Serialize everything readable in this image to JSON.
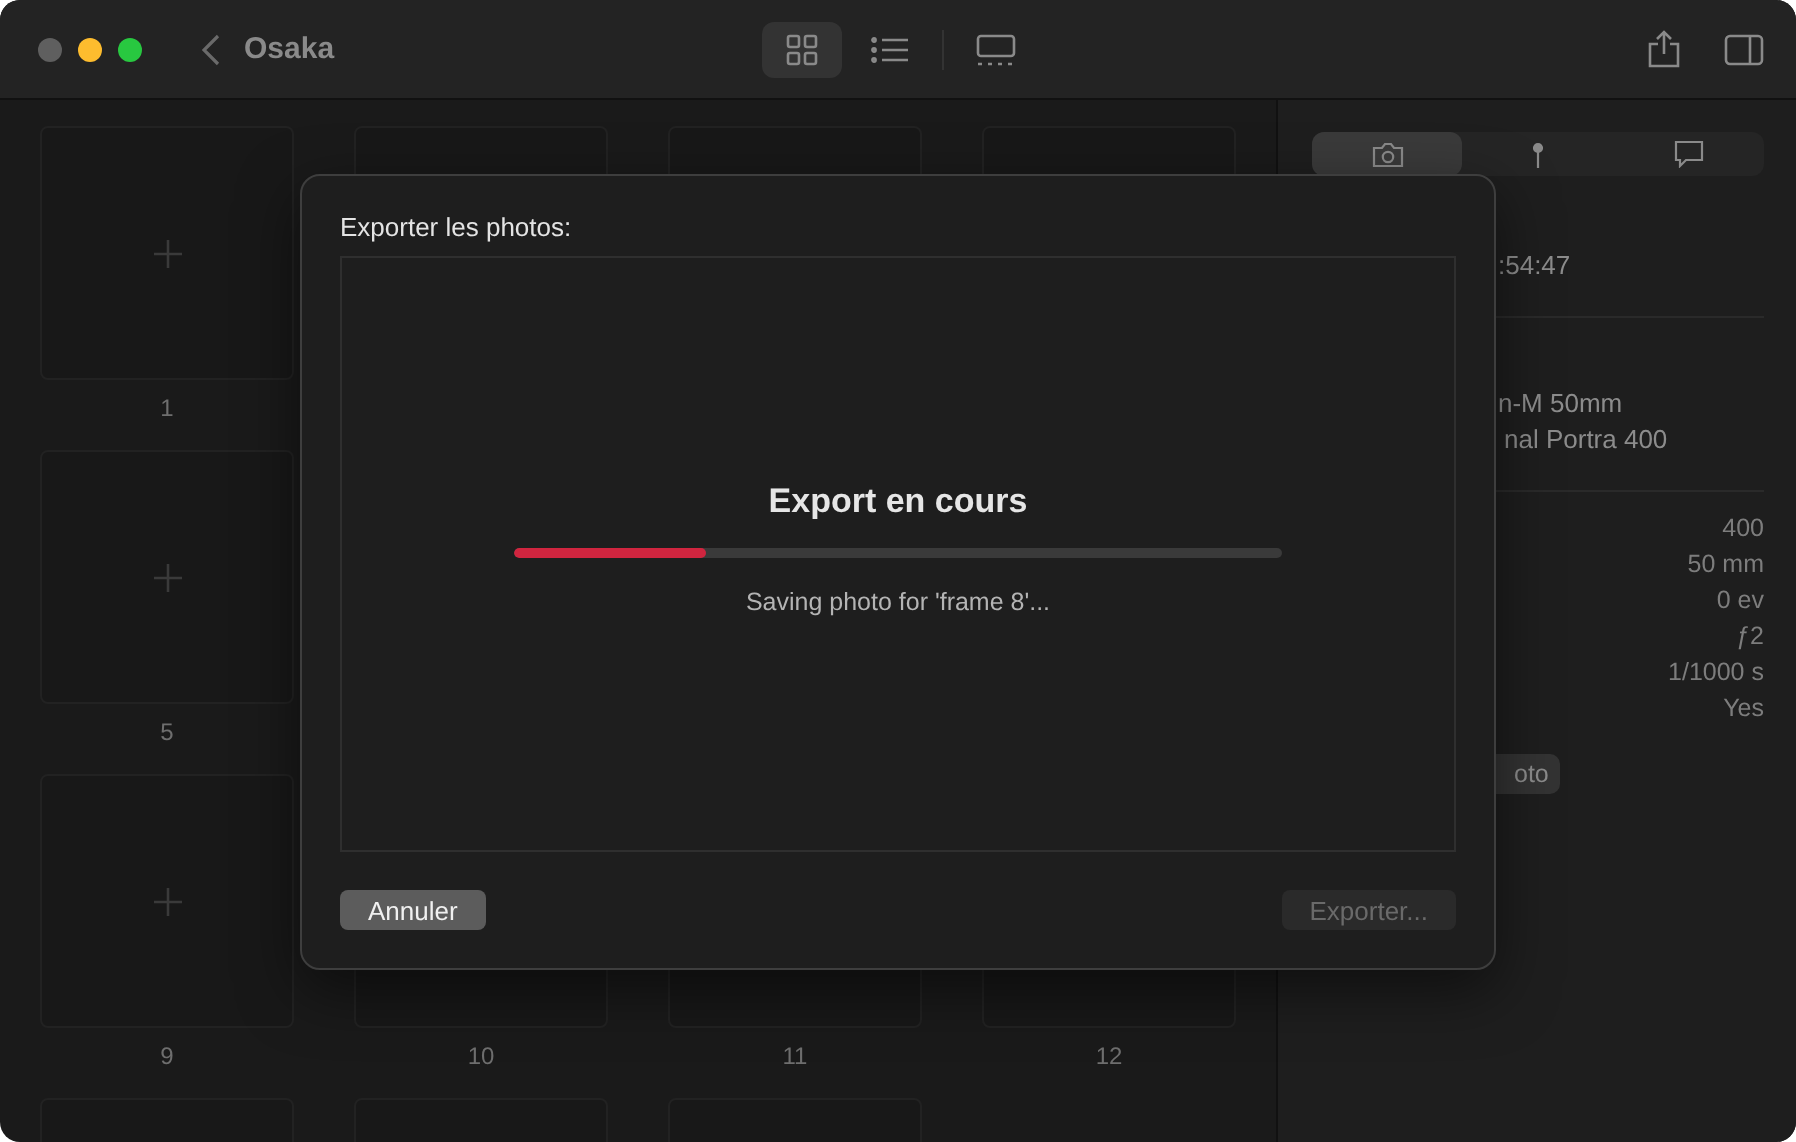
{
  "window": {
    "title": "Osaka"
  },
  "toolbar": {
    "views": [
      {
        "kind": "grid",
        "selected": true
      },
      {
        "kind": "list",
        "selected": false
      },
      {
        "kind": "gallery",
        "selected": false
      }
    ]
  },
  "grid": {
    "rows": [
      [
        {
          "kind": "placeholder",
          "label": "1"
        },
        {
          "kind": "frame"
        },
        {
          "kind": "frame"
        },
        {
          "kind": "frame"
        }
      ],
      [
        {
          "kind": "placeholder",
          "label": "5"
        }
      ],
      [
        {
          "kind": "placeholder",
          "label": "9"
        },
        {
          "kind": "frame",
          "label": "10"
        },
        {
          "kind": "frame",
          "label": "11"
        },
        {
          "kind": "frame",
          "label": "12"
        }
      ],
      [
        {
          "kind": "frame"
        },
        {
          "kind": "frame"
        },
        {
          "kind": "frame"
        }
      ]
    ]
  },
  "sidebar": {
    "tabs": [
      {
        "kind": "camera",
        "selected": true
      },
      {
        "kind": "location",
        "selected": false
      },
      {
        "kind": "notes",
        "selected": false
      }
    ],
    "date": ":54:47",
    "gear": [
      "n-M 50mm",
      "nal Portra 400"
    ],
    "values": [
      "400",
      "50 mm",
      "0 ev",
      "ƒ2",
      "1/1000 s",
      "Yes"
    ],
    "button": "oto"
  },
  "dialog": {
    "title": "Exporter les photos:",
    "heading": "Export en cours",
    "progress": {
      "level": 0.25
    },
    "status": "Saving photo for 'frame 8'...",
    "buttons": [
      {
        "label": "Annuler",
        "disabled": false
      },
      {
        "label": "Exporter...",
        "disabled": true
      }
    ]
  }
}
